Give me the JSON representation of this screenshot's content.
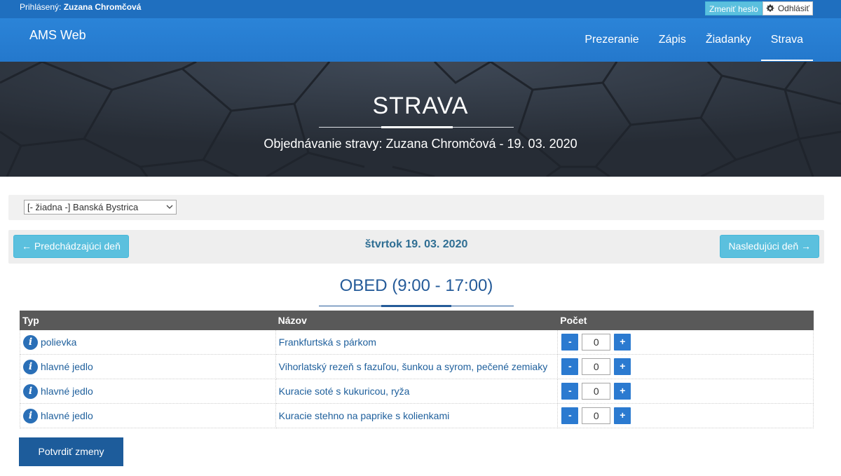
{
  "topbar": {
    "logged_label": "Prihlásený:",
    "user_name": "Zuzana Chromčová",
    "change_password": "Zmeniť heslo",
    "logout": "Odhlásiť"
  },
  "navbar": {
    "brand": "AMS Web",
    "items": [
      {
        "label": "Prezeranie",
        "active": false
      },
      {
        "label": "Zápis",
        "active": false
      },
      {
        "label": "Žiadanky",
        "active": false
      },
      {
        "label": "Strava",
        "active": true
      }
    ]
  },
  "hero": {
    "title": "STRAVA",
    "subtitle": "Objednávanie stravy: Zuzana Chromčová - 19. 03. 2020"
  },
  "filter": {
    "selected": "[- žiadna -] Banská Bystrica"
  },
  "daynav": {
    "prev": "← Predchádzajúci deň",
    "day": "štvrtok 19. 03. 2020",
    "next": "Nasledujúci deň →"
  },
  "section": {
    "title": "OBED (9:00 - 17:00)"
  },
  "table": {
    "headers": [
      "Typ",
      "Názov",
      "Počet"
    ],
    "rows": [
      {
        "typ": "polievka",
        "nazov": "Frankfurtská s párkom",
        "pocet": "0"
      },
      {
        "typ": "hlavné jedlo",
        "nazov": "Vihorlatský rezeň s fazuľou, šunkou a syrom, pečené zemiaky",
        "pocet": "0"
      },
      {
        "typ": "hlavné jedlo",
        "nazov": "Kuracie soté s kukuricou, ryža",
        "pocet": "0"
      },
      {
        "typ": "hlavné jedlo",
        "nazov": "Kuracie stehno na paprike s kolienkami",
        "pocet": "0"
      }
    ],
    "minus_label": "-",
    "plus_label": "+",
    "info_label": "i"
  },
  "confirm": "Potvrdiť zmeny",
  "colors": {
    "topbar": "#1f6fbf",
    "navbar": "#2a7fd4",
    "hero": "#2e3540",
    "info_button": "#5bc0de",
    "primary": "#2b7ad0",
    "confirm": "#1d5c9b",
    "table_header": "#595959"
  }
}
